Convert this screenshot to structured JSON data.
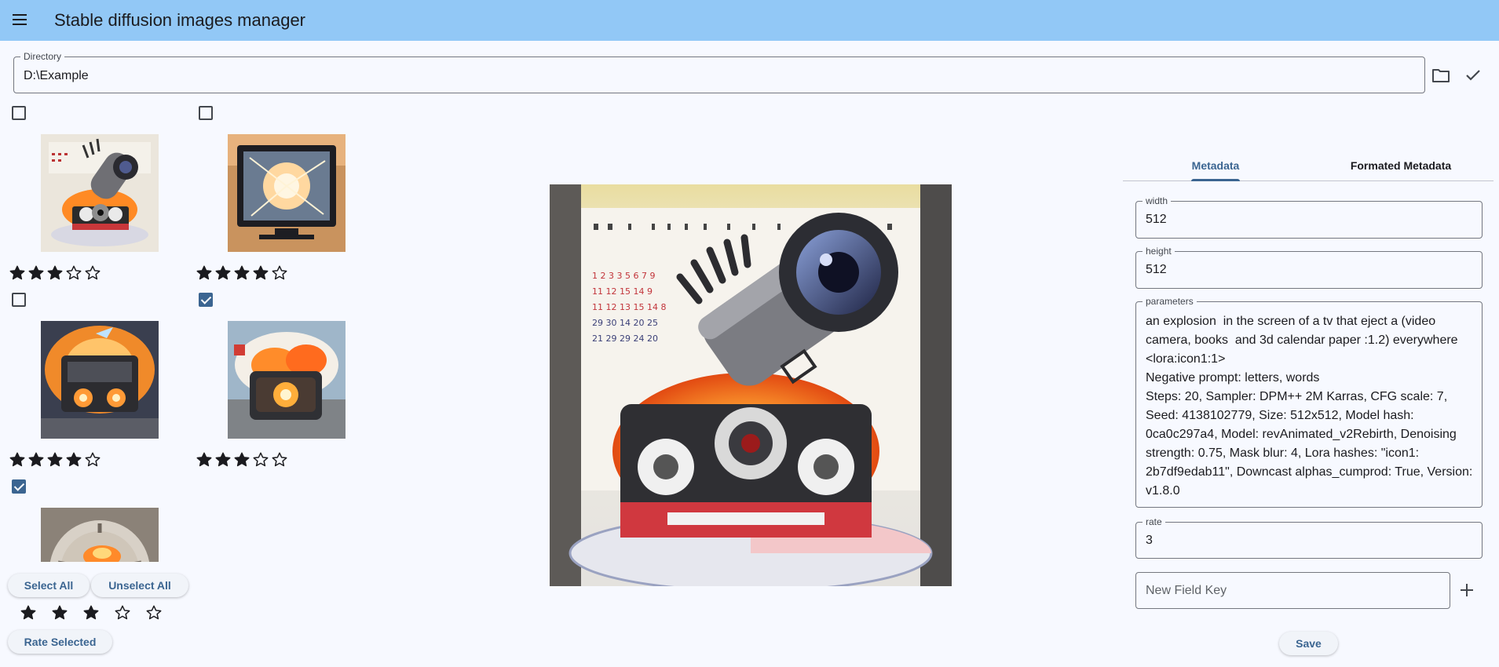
{
  "app": {
    "title": "Stable diffusion images manager",
    "menu_icon": "hamburger-menu-icon"
  },
  "directory": {
    "label": "Directory",
    "value": "D:\\Example",
    "browse_icon": "folder-icon",
    "confirm_icon": "check-icon"
  },
  "grid": {
    "items": [
      {
        "checked": false,
        "rating": 3,
        "max_rating": 5,
        "image": "camera-explosion-calendar-thumbnail"
      },
      {
        "checked": false,
        "rating": 4,
        "max_rating": 5,
        "image": "monitor-explosion-thumbnail"
      },
      {
        "checked": false,
        "rating": 4,
        "max_rating": 5,
        "image": "tv-box-explosion-thumbnail"
      },
      {
        "checked": true,
        "rating": 3,
        "max_rating": 5,
        "image": "tv-explosion-clouds-thumbnail"
      },
      {
        "checked": true,
        "rating": null,
        "max_rating": 5,
        "image": "clock-explosion-thumbnail"
      }
    ]
  },
  "actions": {
    "select_all": "Select All",
    "unselect_all": "Unselect All",
    "bulk_rating": 3,
    "bulk_max_rating": 5,
    "rate_selected": "Rate Selected"
  },
  "preview": {
    "image": "camera-explosion-calendar-preview"
  },
  "metadata": {
    "tabs": [
      {
        "label": "Metadata",
        "active": true
      },
      {
        "label": "Formated Metadata",
        "active": false
      }
    ],
    "fields": {
      "width": {
        "label": "width",
        "value": "512"
      },
      "height": {
        "label": "height",
        "value": "512"
      },
      "parameters": {
        "label": "parameters",
        "value": "an explosion  in the screen of a tv that eject a (video camera, books  and 3d calendar paper :1.2) everywhere\n<lora:icon1:1>\nNegative prompt: letters, words\nSteps: 20, Sampler: DPM++ 2M Karras, CFG scale: 7, Seed: 4138102779, Size: 512x512, Model hash: 0ca0c297a4, Model: revAnimated_v2Rebirth, Denoising strength: 0.75, Mask blur: 4, Lora hashes: \"icon1: 2b7df9edab11\", Downcast alphas_cumprod: True, Version: v1.8.0"
      },
      "rate": {
        "label": "rate",
        "value": "3"
      }
    },
    "new_field_placeholder": "New Field Key",
    "add_icon": "plus-icon",
    "save_label": "Save"
  },
  "colors": {
    "appbar": "#92c8f6",
    "accent": "#3b6591",
    "background": "#f7f9ff"
  }
}
